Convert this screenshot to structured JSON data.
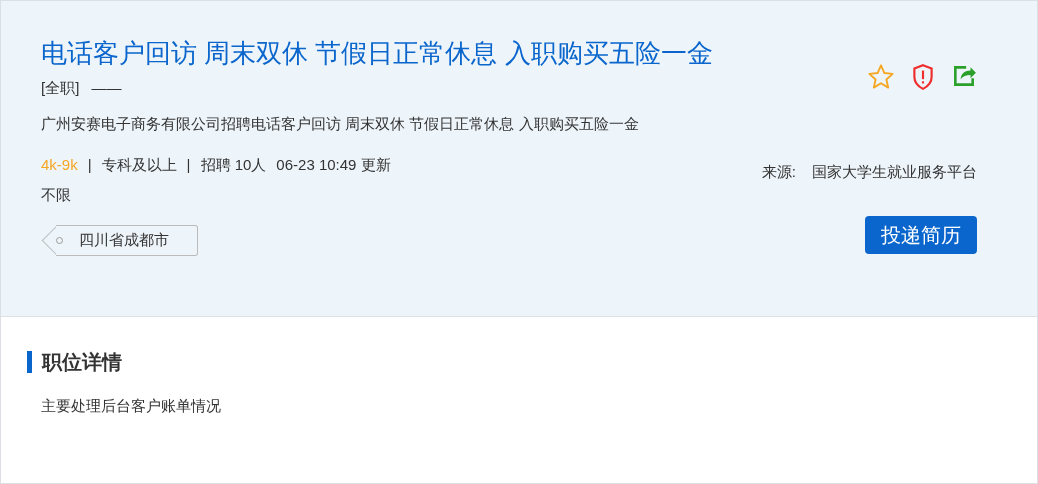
{
  "job": {
    "title": "电话客户回访 周末双休 节假日正常休息 入职购买五险一金",
    "type": "[全职]",
    "type_extra": "——",
    "summary": "广州安赛电子商务有限公司招聘电话客户回访 周末双休 节假日正常休息 入职购买五险一金",
    "meta": [
      {
        "kind": "salary",
        "text": "4k-9k"
      },
      {
        "kind": "sep",
        "text": "|"
      },
      {
        "kind": "plain",
        "text": "专科及以上"
      },
      {
        "kind": "sep",
        "text": "|"
      },
      {
        "kind": "plain",
        "text": "招聘 10人"
      },
      {
        "kind": "plain",
        "text": "06-23 10:49 更新"
      }
    ],
    "requirement": "不限",
    "location": "四川省成都市",
    "source_label": "来源:",
    "source": "国家大学生就业服务平台",
    "apply_button": "投递简历"
  },
  "details": {
    "heading": "职位详情",
    "body": "主要处理后台客户账单情况"
  }
}
